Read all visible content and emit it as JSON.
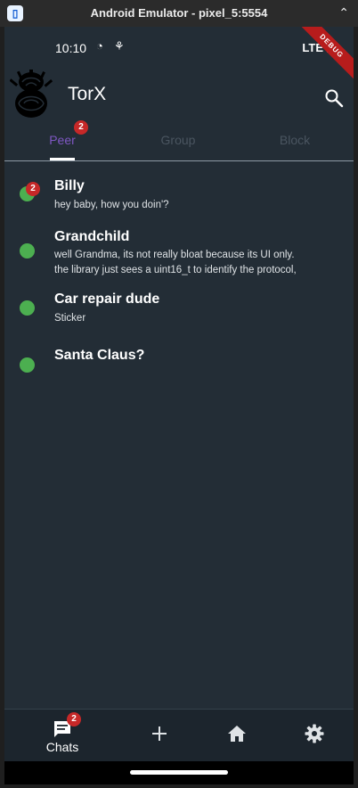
{
  "window": {
    "title": "Android Emulator - pixel_5:5554"
  },
  "status_bar": {
    "time": "10:10",
    "network": "LTE",
    "debug_banner": "DEBUG"
  },
  "app_bar": {
    "title": "TorX"
  },
  "tabs": [
    {
      "label": "Peer",
      "badge": "2",
      "active": true
    },
    {
      "label": "Group",
      "active": false
    },
    {
      "label": "Block",
      "active": false
    }
  ],
  "conversations": [
    {
      "name": "Billy",
      "badge": "2",
      "status": "online",
      "message_lines": [
        "hey baby, how you doin'?"
      ]
    },
    {
      "name": "Grandchild",
      "status": "online",
      "message_lines": [
        "well Grandma, its not really bloat because its UI only.",
        "the library just sees a uint16_t to identify the protocol,"
      ]
    },
    {
      "name": "Car repair dude",
      "status": "online",
      "message_lines": [
        "Sticker"
      ]
    },
    {
      "name": "Santa Claus?",
      "status": "online",
      "message_lines": []
    }
  ],
  "bottom_nav": [
    {
      "label": "Chats",
      "icon": "chat-icon",
      "badge": "2"
    },
    {
      "label": "",
      "icon": "add-icon"
    },
    {
      "label": "",
      "icon": "home-icon"
    },
    {
      "label": "",
      "icon": "settings-icon"
    }
  ],
  "colors": {
    "background": "#232d36",
    "accent": "#7e57c2",
    "online": "#4caf50",
    "badge": "#c62828"
  }
}
